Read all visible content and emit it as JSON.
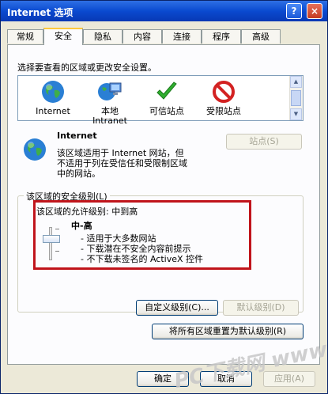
{
  "window": {
    "title": "Internet 选项",
    "help_label": "?",
    "close_label": "×"
  },
  "tabs": [
    {
      "label": "常规"
    },
    {
      "label": "安全"
    },
    {
      "label": "隐私"
    },
    {
      "label": "内容"
    },
    {
      "label": "连接"
    },
    {
      "label": "程序"
    },
    {
      "label": "高级"
    }
  ],
  "active_tab": "安全",
  "security": {
    "zone_prompt": "选择要查看的区域或更改安全设置。",
    "zones": [
      {
        "label": "Internet",
        "icon": "globe-icon"
      },
      {
        "label": "本地\nIntranet",
        "icon": "intranet-icon"
      },
      {
        "label": "可信站点",
        "icon": "checkmark-icon"
      },
      {
        "label": "受限站点",
        "icon": "prohibited-icon"
      }
    ],
    "selected_zone": {
      "name": "Internet",
      "description_line1": "该区域适用于 Internet 网站，但",
      "description_line2": "不适用于列在受信任和受限制区域",
      "description_line3": "中的网站。"
    },
    "sites_button": "站点(S)",
    "level_group_title": "该区域的安全级别(L)",
    "allowed_level_text": "该区域的允许级别: 中到高",
    "level_name": "中-高",
    "level_points": [
      "- 适用于大多数网站",
      "- 下载潜在不安全内容前提示",
      "- 不下载未签名的 ActiveX 控件"
    ],
    "custom_level_button": "自定义级别(C)...",
    "default_level_button": "默认级别(D)",
    "reset_all_button": "将所有区域重置为默认级别(R)"
  },
  "footer": {
    "ok": "确定",
    "cancel": "取消",
    "apply": "应用(A)"
  },
  "watermark": "PC下载网 www.pcsoft.com.cn",
  "colors": {
    "titlebar": "#0a4ad0",
    "highlight_box": "#c0141b",
    "tab_accent": "#ffc83c"
  }
}
